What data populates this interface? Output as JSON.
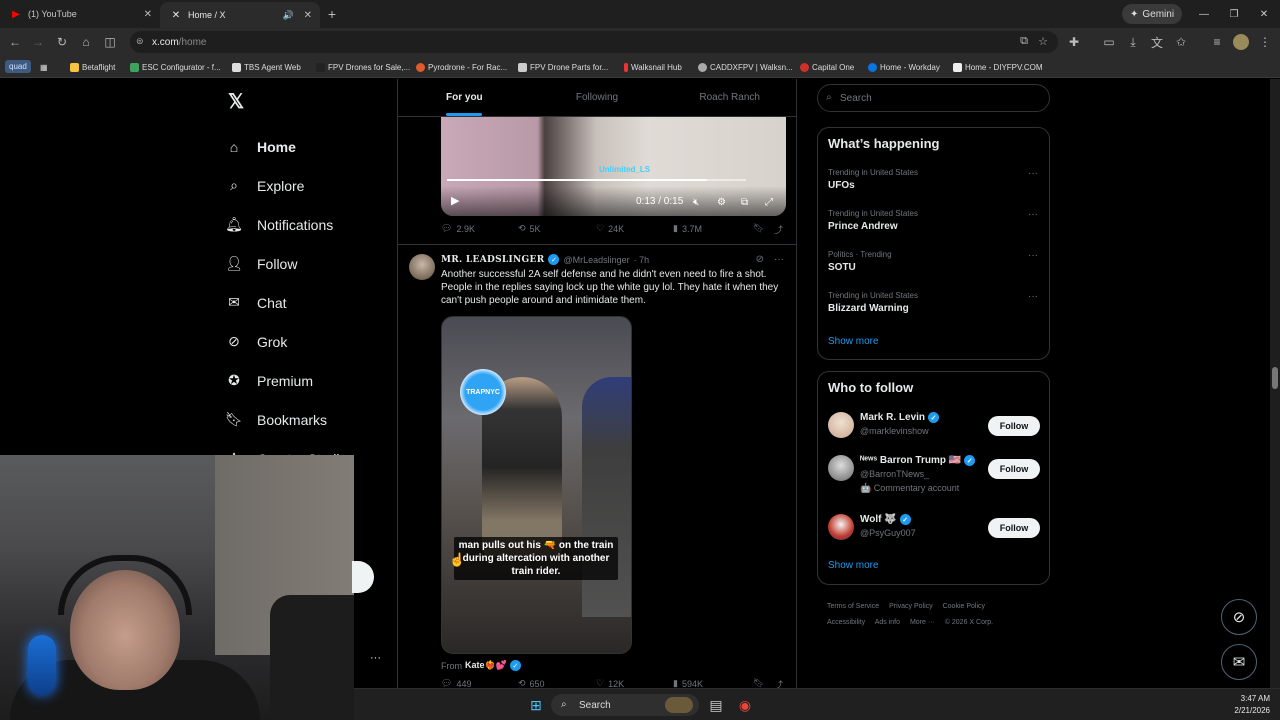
{
  "browser": {
    "tabs": [
      {
        "title": "(1) YouTube",
        "icon": "youtube-icon"
      },
      {
        "title": "Home / X",
        "icon": "x-icon"
      }
    ],
    "gemini_label": "Gemini",
    "url_host": "x.com",
    "url_path": "/home",
    "bookmarks": [
      {
        "label": "quad"
      },
      {
        "label": "Betaflight"
      },
      {
        "label": "ESC Configurator - f..."
      },
      {
        "label": "TBS Agent Web"
      },
      {
        "label": "FPV Drones for Sale,..."
      },
      {
        "label": "Pyrodrone - For Rac..."
      },
      {
        "label": "FPV Drone Parts for..."
      },
      {
        "label": "Walksnail Hub"
      },
      {
        "label": "CADDXFPV | Walksn..."
      },
      {
        "label": "Capital One"
      },
      {
        "label": "Home - Workday"
      },
      {
        "label": "Home - DIYFPV.COM"
      }
    ]
  },
  "nav": {
    "logo": "𝕏",
    "items": [
      {
        "label": "Home",
        "icon": "home-icon"
      },
      {
        "label": "Explore",
        "icon": "search-icon"
      },
      {
        "label": "Notifications",
        "icon": "bell-icon"
      },
      {
        "label": "Follow",
        "icon": "follow-icon"
      },
      {
        "label": "Chat",
        "icon": "mail-icon"
      },
      {
        "label": "Grok",
        "icon": "grok-icon"
      },
      {
        "label": "Premium",
        "icon": "premium-icon"
      },
      {
        "label": "Bookmarks",
        "icon": "bookmark-icon"
      },
      {
        "label": "Creator Studio",
        "icon": "creator-icon"
      }
    ]
  },
  "feed": {
    "tabs": [
      "For you",
      "Following",
      "Roach Ranch"
    ],
    "post1": {
      "watermark": "Unlimited_LS",
      "time": "0:13 / 0:15",
      "progress": 0.87,
      "replies": "2.9K",
      "reposts": "5K",
      "likes": "24K",
      "views": "3.7M"
    },
    "post2": {
      "name": "MR. LEADSLINGER",
      "handle": "@MrLeadslinger",
      "time": "· 7h",
      "text": "Another successful 2A self defense and he didn't even need to fire a shot. People in the replies saying lock up the white guy lol. They hate it when they can't push people around and intimidate them.",
      "video_badge": "TRAPNYC",
      "caption": "man pulls out his 🔫 on the train during altercation with another train rider.",
      "from_label": "From",
      "from_name": "Kate❤️‍🔥💕",
      "replies": "449",
      "reposts": "650",
      "likes": "12K",
      "views": "594K"
    }
  },
  "sidebar": {
    "search_placeholder": "Search",
    "whats_happening": "What’s happening",
    "trends": [
      {
        "context": "Trending in United States",
        "title": "UFOs"
      },
      {
        "context": "Trending in United States",
        "title": "Prince Andrew"
      },
      {
        "context": "Politics · Trending",
        "title": "SOTU"
      },
      {
        "context": "Trending in United States",
        "title": "Blizzard Warning"
      }
    ],
    "show_more": "Show more",
    "who_to_follow": "Who to follow",
    "follow_suggestions": [
      {
        "name": "Mark R. Levin",
        "handle": "@marklevinshow",
        "extra": "",
        "button": "Follow"
      },
      {
        "name": "ᴺᵉʷˢ Barron Trump 🇺🇸",
        "handle": "@BarronTNews_",
        "extra": "🤖 Commentary account",
        "button": "Follow"
      },
      {
        "name": "Wolf 🐺",
        "handle": "@PsyGuy007",
        "extra": "",
        "button": "Follow"
      }
    ],
    "footer": [
      "Terms of Service",
      "Privacy Policy",
      "Cookie Policy",
      "Accessibility",
      "Ads info",
      "More ···",
      "© 2026 X Corp."
    ]
  },
  "taskbar": {
    "search_label": "Search",
    "time": "3:47 AM",
    "date": "2/21/2026"
  },
  "colors": {
    "accent": "#1d9bf0",
    "background": "#000000",
    "border": "#2f3336",
    "muted_text": "#71767b"
  }
}
